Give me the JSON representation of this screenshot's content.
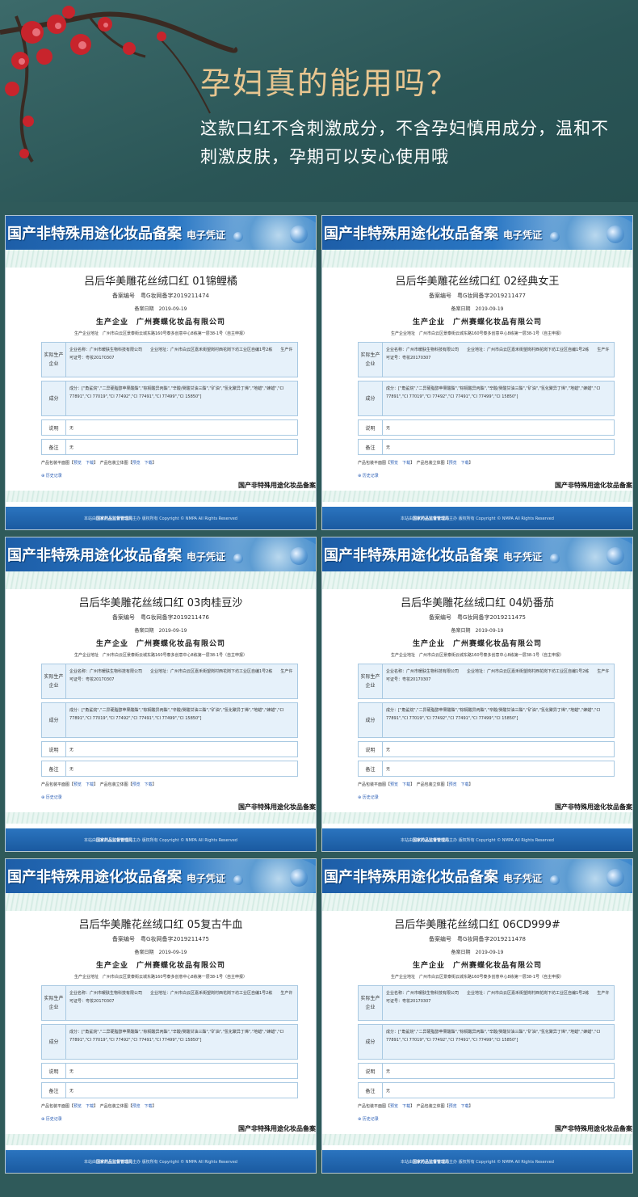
{
  "hero": {
    "title": "孕妇真的能用吗？",
    "description": "这款口红不含刺激成分，不含孕妇慎用成分，温和不刺激皮肤，孕期可以安心使用哦"
  },
  "cert_common": {
    "header_title": "国产非特殊用途化妆品备案",
    "header_sub": "电子凭证",
    "reg_label": "备案编号",
    "date_label": "备案日期",
    "date": "2019-09-19",
    "enterprise_label": "生产企业",
    "enterprise": "广州赛蝶化妆品有限公司",
    "address_label": "生产企业地址",
    "address": "广州市白云区景泰街云城东路160号泰多创意中心8栋第一层38-1号（自主申报）",
    "actual_label": "实际生产企业",
    "actual_text": "企业名称：广州市暖肤生物科技有限公司　　企业地址：广州市白云区嘉禾街望岗村西花岗下坊工业区自编1号2栋　　生产许可证号：粤妆20170307",
    "ingredients_label": "成分",
    "ingredients_text": "成分：[\"角鲨烷\",\"二异硬脂醇苹果酸酯\",\"棕榈酸异丙酯\",\"辛酸/癸酸甘油三酯\",\"矿油\",\"氢化聚异丁烯\",\"地蜡\",\"蜂蜡\",\"CI 77891\",\"CI 77019\",\"CI 77492\",\"CI 77491\",\"CI 77499\",\"CI 15850\"]",
    "note_label": "说明",
    "note_value": "无",
    "remark_label": "备注",
    "remark_value": "无",
    "flat_label": "产品包装平面图",
    "stereo_label": "产品包装立体图",
    "view": "预览",
    "download": "下载",
    "history": "历史记录",
    "stamp": "国产非特殊用途化妆品备案",
    "footer_pre": "本站由",
    "footer_org": "国家药品监督管理局",
    "footer_post": "主办 版权所有 Copyright © NMPA All Rights Reserved"
  },
  "certs": [
    {
      "name": "吕后华美雕花丝绒口红 01锦鲤橘",
      "reg": "粤G妆网备字2019211474"
    },
    {
      "name": "吕后华美雕花丝绒口红 02经典女王",
      "reg": "粤G妆网备字2019211477"
    },
    {
      "name": "吕后华美雕花丝绒口红 03肉桂豆沙",
      "reg": "粤G妆网备字2019211476"
    },
    {
      "name": "吕后华美雕花丝绒口红 04奶番茄",
      "reg": "粤G妆网备字2019211475"
    },
    {
      "name": "吕后华美雕花丝绒口红 05复古牛血",
      "reg": "粤G妆网备字2019211475"
    },
    {
      "name": "吕后华美雕花丝绒口红 06CD999#",
      "reg": "粤G妆网备字2019211478"
    }
  ]
}
